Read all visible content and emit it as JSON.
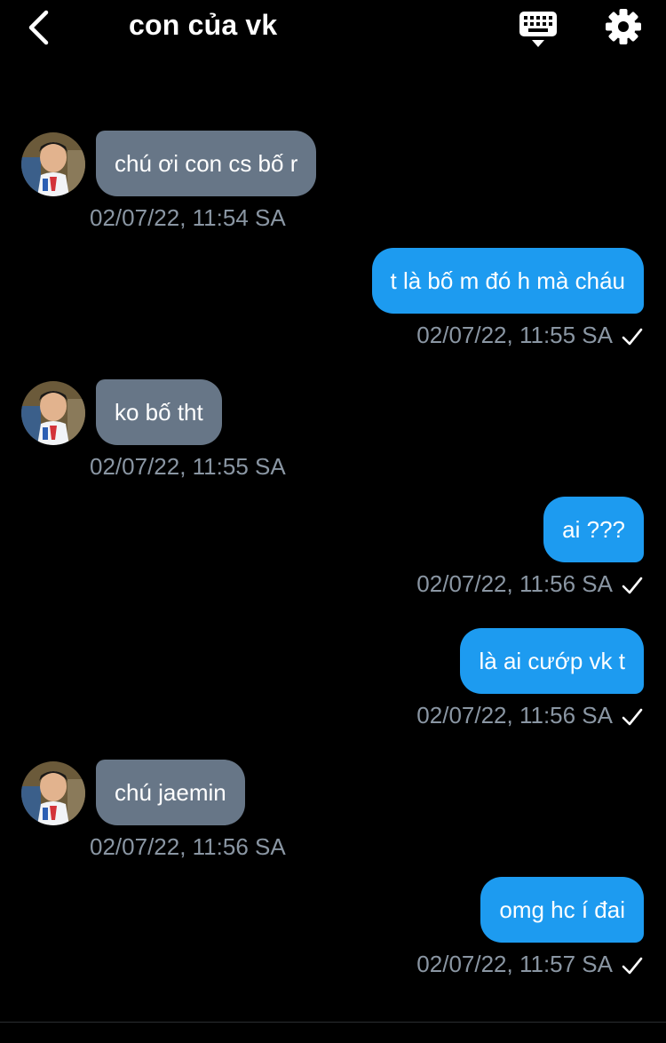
{
  "header": {
    "title": "con của vk",
    "back_icon": "chevron-left-icon",
    "keyboard_icon": "keyboard-icon",
    "settings_icon": "gear-icon"
  },
  "colors": {
    "background": "#000000",
    "incoming_bubble": "#677687",
    "outgoing_bubble": "#1d9bf0",
    "timestamp": "#8a96a3"
  },
  "messages": [
    {
      "direction": "incoming",
      "text": "chú ơi con cs bố r",
      "time": "02/07/22, 11:54 SA"
    },
    {
      "direction": "outgoing",
      "text": "t là bố m đó h mà cháu",
      "time": "02/07/22, 11:55 SA"
    },
    {
      "direction": "incoming",
      "text": "ko bố tht",
      "time": "02/07/22, 11:55 SA"
    },
    {
      "direction": "outgoing",
      "text": "ai ???",
      "time": "02/07/22, 11:56 SA"
    },
    {
      "direction": "outgoing",
      "text": "là ai cướp vk t",
      "time": "02/07/22, 11:56 SA"
    },
    {
      "direction": "incoming",
      "text": "chú jaemin",
      "time": "02/07/22, 11:56 SA"
    },
    {
      "direction": "outgoing",
      "text": "omg hc í đai",
      "time": "02/07/22, 11:57 SA"
    }
  ]
}
